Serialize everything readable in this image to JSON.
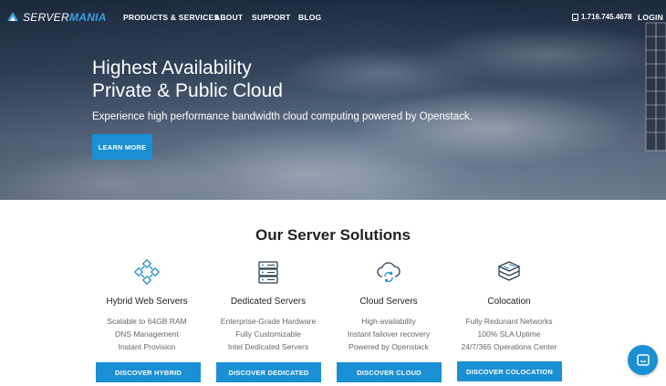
{
  "nav": {
    "logo_prefix": "SERVER",
    "logo_accent": "MANIA",
    "links": [
      "PRODUCTS & SERVICES",
      "ABOUT",
      "SUPPORT",
      "BLOG"
    ],
    "phone": "1.716.745.4678",
    "login": "LOGIN"
  },
  "hero": {
    "title_line1": "Highest Availability",
    "title_line2": "Private & Public Cloud",
    "subtitle": "Experience high performance bandwidth cloud computing powered by Openstack.",
    "cta": "LEARN MORE"
  },
  "solutions": {
    "title": "Our Server Solutions",
    "cards": [
      {
        "icon": "network-nodes-icon",
        "name": "Hybrid Web Servers",
        "features": [
          "Scalable to 64GB RAM",
          "DNS Management",
          "Instant Provision"
        ],
        "button": "DISCOVER HYBRID"
      },
      {
        "icon": "server-rack-icon",
        "name": "Dedicated Servers",
        "features": [
          "Enterprise-Grade Hardware",
          "Fully Customizable",
          "Intel Dedicated Servers"
        ],
        "button": "DISCOVER DEDICATED"
      },
      {
        "icon": "cloud-sync-icon",
        "name": "Cloud Servers",
        "features": [
          "High-availability",
          "Instant failover recovery",
          "Powered by Openstack"
        ],
        "button": "DISCOVER CLOUD"
      },
      {
        "icon": "stacked-layers-icon",
        "name": "Colocation",
        "features": [
          "Fully Redunant Networks",
          "100% SLA Uptime",
          "24/7/365 Operations Center"
        ],
        "button": "DISCOVER COLOCATION"
      }
    ]
  },
  "colors": {
    "accent": "#1a8fd3",
    "icon_blue": "#1a8fd3",
    "icon_dark": "#2f3e50"
  }
}
